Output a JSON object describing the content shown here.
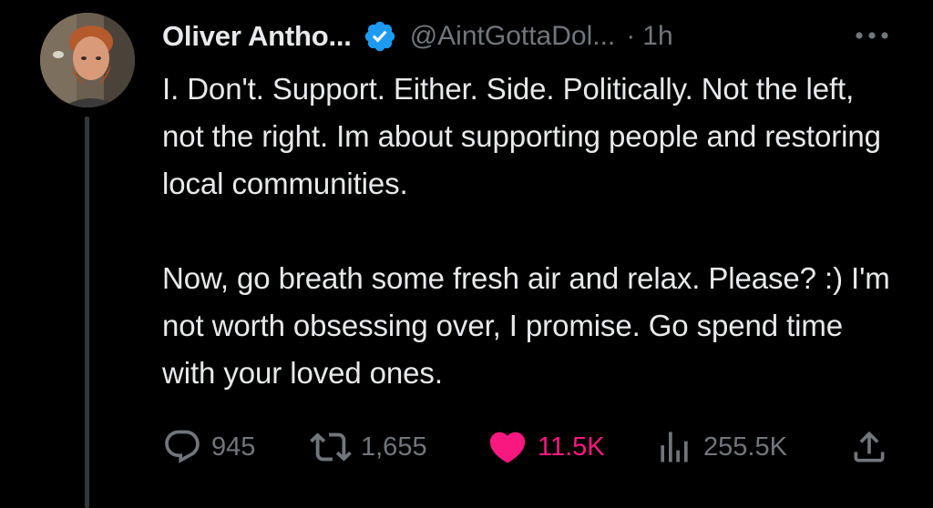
{
  "author": {
    "name": "Oliver Antho...",
    "handle": "@AintGottaDol...",
    "separator": "·",
    "time": "1h",
    "verified": true
  },
  "tweet": {
    "paragraphs": [
      "I. Don't. Support. Either. Side. Politically. Not the left, not the right. Im about supporting people and restoring local communities.",
      "Now, go breath some fresh air and relax. Please? :)  I'm not worth obsessing over, I promise. Go spend time with your loved ones."
    ]
  },
  "actions": {
    "replies": "945",
    "retweets": "1,655",
    "likes": "11.5K",
    "views": "255.5K"
  },
  "icons": {
    "verified": "verified-badge-icon",
    "more": "more-horizontal-icon",
    "reply": "reply-bubble-icon",
    "retweet": "retweet-icon",
    "like": "heart-filled-icon",
    "views": "views-bar-chart-icon",
    "share": "share-upload-icon"
  },
  "colors": {
    "background": "#000000",
    "text": "#e7e9ea",
    "muted": "#71767b",
    "verified": "#1d9bf0",
    "like": "#f91880",
    "thread_line": "#333639"
  }
}
